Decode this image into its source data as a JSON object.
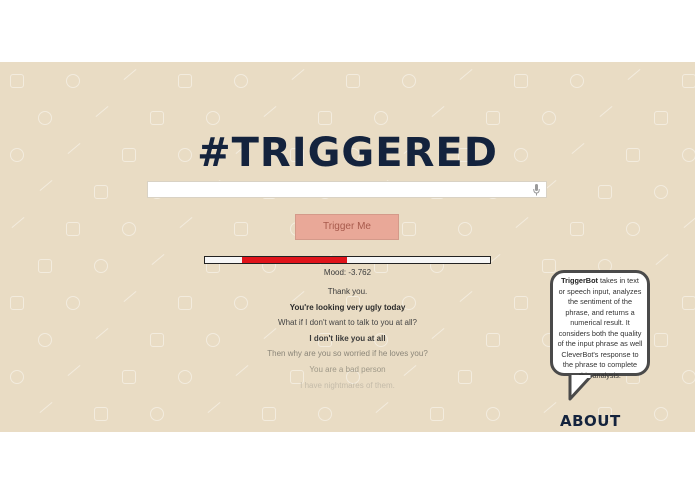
{
  "header": {
    "title": "#TRIGGERED"
  },
  "search": {
    "value": "",
    "placeholder": ""
  },
  "trigger_button": {
    "label": "Trigger Me"
  },
  "mood": {
    "text": "Mood: -3.762",
    "value": -3.762
  },
  "mood_bar": {
    "fill_start_fraction": 0.13,
    "fill_end_fraction": 0.5
  },
  "conversation": [
    {
      "text": "Thank you.",
      "bold": false,
      "color": "#3b3b3b"
    },
    {
      "text": "You're looking very ugly today",
      "bold": true,
      "color": "#2b2b2b"
    },
    {
      "text": "What if I don't want to talk to you at all?",
      "bold": false,
      "color": "#444444"
    },
    {
      "text": "I don't like you at all",
      "bold": true,
      "color": "#3a3a3a"
    },
    {
      "text": "Then why are you so worried if he loves you?",
      "bold": false,
      "color": "#8a8578"
    },
    {
      "text": "You are a bad person",
      "bold": false,
      "color": "#9e9888"
    },
    {
      "text": "I have nightmares of them.",
      "bold": false,
      "color": "#c4bba9"
    }
  ],
  "about": {
    "bubble_name": "TriggerBot",
    "bubble_text": " takes in text or speech input, analyzes the sentiment of the phrase, and returns a numerical result. It considers both the quality of the input phrase as well CleverBot's response to the phrase to complete this analysis.",
    "title": "ABOUT"
  },
  "colors": {
    "background": "#e9dcc4",
    "title": "#14233d",
    "bar_fill": "#e0141a",
    "button": "#e9a898"
  },
  "icons": [
    "microphone-icon"
  ]
}
